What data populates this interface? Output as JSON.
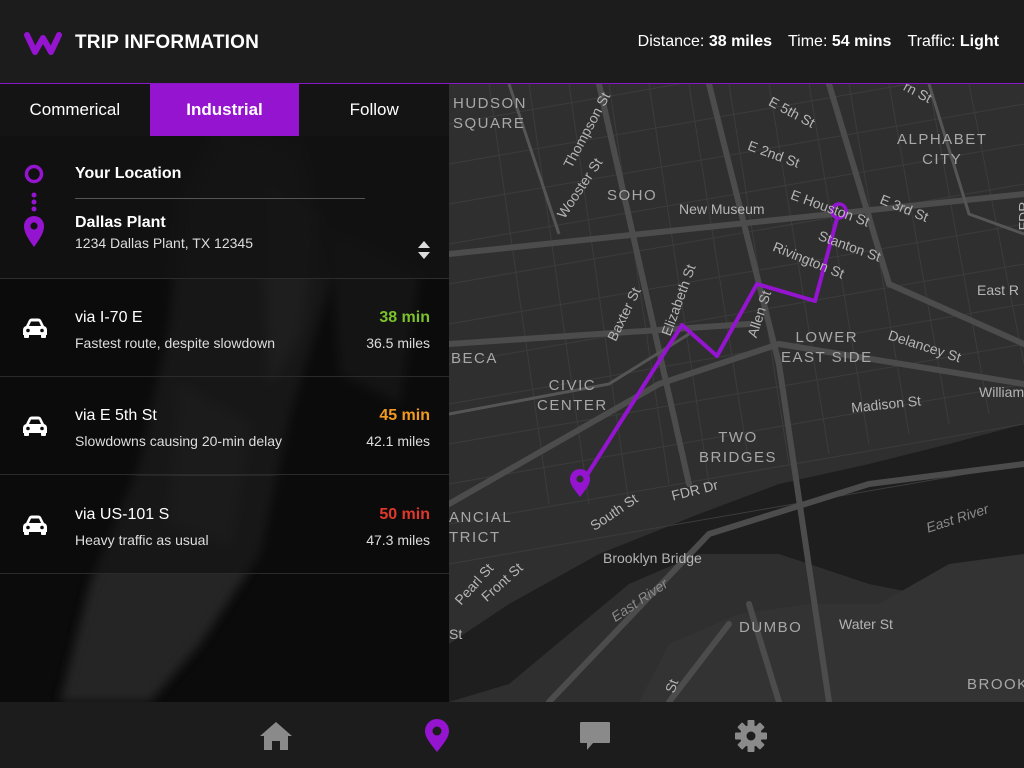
{
  "header": {
    "title": "TRIP INFORMATION",
    "distance_label": "Distance:",
    "distance_value": "38 miles",
    "time_label": "Time:",
    "time_value": "54 mins",
    "traffic_label": "Traffic:",
    "traffic_value": "Light"
  },
  "tabs": [
    {
      "label": "Commerical",
      "active": false
    },
    {
      "label": "Industrial",
      "active": true
    },
    {
      "label": "Follow",
      "active": false
    }
  ],
  "location": {
    "from": "Your Location",
    "to_name": "Dallas Plant",
    "to_address": "1234 Dallas Plant, TX 12345"
  },
  "routes": [
    {
      "name": "via I-70 E",
      "description": "Fastest route, despite slowdown",
      "time": "38 min",
      "distance": "36.5 miles",
      "time_color": "#7cc22c"
    },
    {
      "name": "via E 5th St",
      "description": "Slowdowns causing 20-min delay",
      "time": "45 min",
      "distance": "42.1 miles",
      "time_color": "#f29a1f"
    },
    {
      "name": "via US-101 S",
      "description": "Heavy traffic as usual",
      "time": "50 min",
      "distance": "47.3 miles",
      "time_color": "#e0392b"
    }
  ],
  "map": {
    "labels": {
      "hudson_square": "HUDSON\nSQUARE",
      "soho": "SOHO",
      "new_museum": "New Museum",
      "alphabet_city": "ALPHABET\nCITY",
      "lower_east_side": "LOWER\nEAST SIDE",
      "civic_center": "CIVIC\nCENTER",
      "two_bridges": "TWO\nBRIDGES",
      "beca": "BECA",
      "financial_district": "ANCIAL\nTRICT",
      "dumbo": "DUMBO",
      "brooklyn_bridge": "Brooklyn Bridge",
      "brook": "BROOK",
      "e_5th_st": "E 5th St",
      "e_2nd_st": "E 2nd St",
      "e_3rd_st": "E 3rd St",
      "e_houston_st": "E Houston St",
      "stanton_st": "Stanton St",
      "rivington_st": "Rivington St",
      "delancey_st": "Delancey St",
      "madison_st": "Madison St",
      "fdr_dr": "FDR Dr",
      "south_st": "South St",
      "thompson_st": "Thompson St",
      "wooster_st": "Wooster St",
      "baxter_st": "Baxter St",
      "elizabeth_st": "Elizabeth St",
      "allen_st": "Allen St",
      "east_river": "East River",
      "east_river_2": "East River",
      "water_st": "Water St",
      "front_st": "Front St",
      "pearl_st": "Pearl St",
      "east_r": "East R",
      "william": "William",
      "st_top": "rn St",
      "fdr_right": "FDR",
      "st_a": "St",
      "st_b": "St"
    },
    "route_color": "#9414d0"
  },
  "nav": {
    "items": [
      "home-icon",
      "location-pin-icon",
      "chat-icon",
      "gear-icon"
    ],
    "active_color": "#9414d0",
    "inactive_color": "#8a8a8a"
  }
}
